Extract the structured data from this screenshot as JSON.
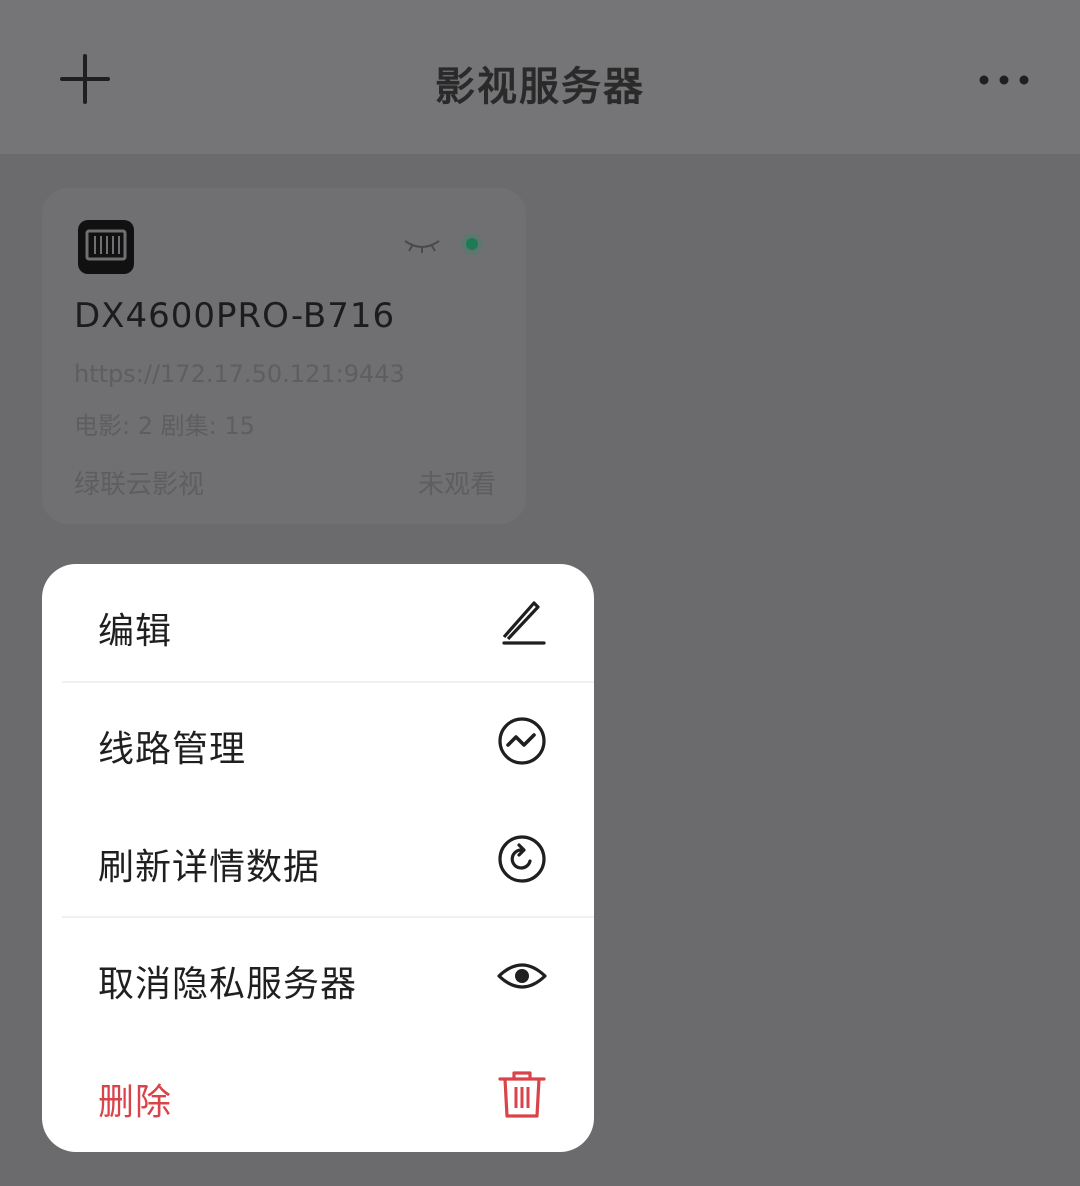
{
  "header": {
    "title": "影视服务器",
    "add_icon": "plus-icon",
    "more_icon": "more-dots-icon"
  },
  "server_card": {
    "name": "DX4600PRO-B716",
    "url": "https://172.17.50.121:9443",
    "stats": "电影: 2 剧集: 15",
    "source": "绿联云影视",
    "watch_status": "未观看",
    "status_color": "#1e7a55"
  },
  "context_menu": {
    "items": [
      {
        "label": "编辑",
        "icon": "edit-pen-icon"
      },
      {
        "label": "线路管理",
        "icon": "route-icon"
      },
      {
        "label": "刷新详情数据",
        "icon": "refresh-icon"
      },
      {
        "label": "取消隐私服务器",
        "icon": "eye-icon"
      },
      {
        "label": "删除",
        "icon": "trash-icon"
      }
    ],
    "danger_color": "#d9434a"
  }
}
